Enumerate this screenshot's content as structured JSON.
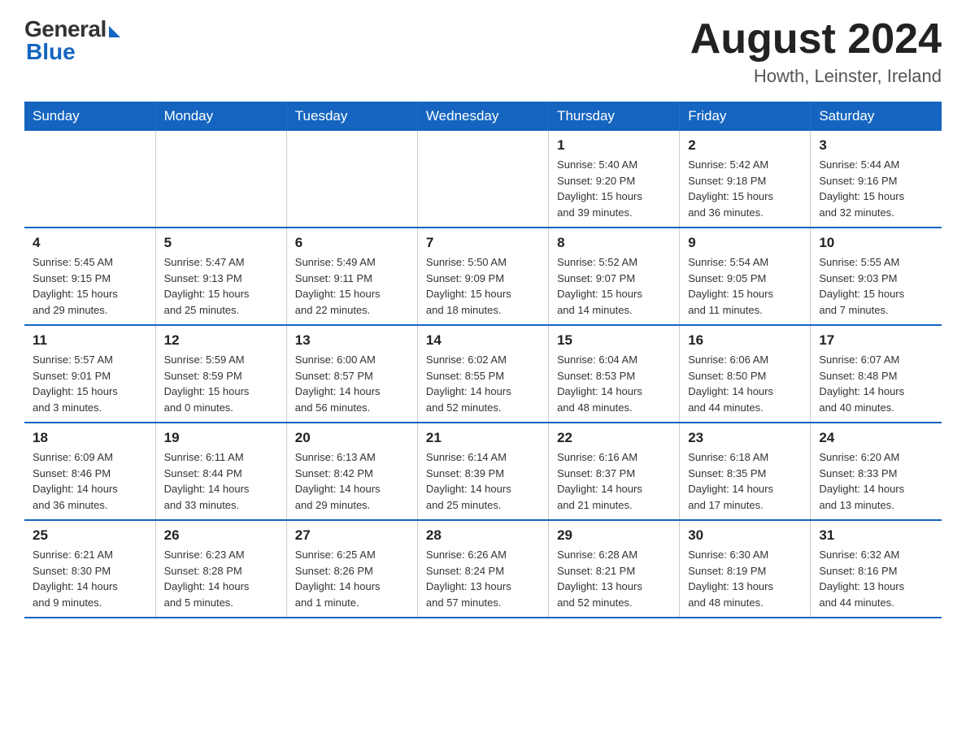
{
  "header": {
    "logo_general": "General",
    "logo_blue": "Blue",
    "month_title": "August 2024",
    "location": "Howth, Leinster, Ireland"
  },
  "days_of_week": [
    "Sunday",
    "Monday",
    "Tuesday",
    "Wednesday",
    "Thursday",
    "Friday",
    "Saturday"
  ],
  "weeks": [
    [
      {
        "day": "",
        "info": ""
      },
      {
        "day": "",
        "info": ""
      },
      {
        "day": "",
        "info": ""
      },
      {
        "day": "",
        "info": ""
      },
      {
        "day": "1",
        "info": "Sunrise: 5:40 AM\nSunset: 9:20 PM\nDaylight: 15 hours\nand 39 minutes."
      },
      {
        "day": "2",
        "info": "Sunrise: 5:42 AM\nSunset: 9:18 PM\nDaylight: 15 hours\nand 36 minutes."
      },
      {
        "day": "3",
        "info": "Sunrise: 5:44 AM\nSunset: 9:16 PM\nDaylight: 15 hours\nand 32 minutes."
      }
    ],
    [
      {
        "day": "4",
        "info": "Sunrise: 5:45 AM\nSunset: 9:15 PM\nDaylight: 15 hours\nand 29 minutes."
      },
      {
        "day": "5",
        "info": "Sunrise: 5:47 AM\nSunset: 9:13 PM\nDaylight: 15 hours\nand 25 minutes."
      },
      {
        "day": "6",
        "info": "Sunrise: 5:49 AM\nSunset: 9:11 PM\nDaylight: 15 hours\nand 22 minutes."
      },
      {
        "day": "7",
        "info": "Sunrise: 5:50 AM\nSunset: 9:09 PM\nDaylight: 15 hours\nand 18 minutes."
      },
      {
        "day": "8",
        "info": "Sunrise: 5:52 AM\nSunset: 9:07 PM\nDaylight: 15 hours\nand 14 minutes."
      },
      {
        "day": "9",
        "info": "Sunrise: 5:54 AM\nSunset: 9:05 PM\nDaylight: 15 hours\nand 11 minutes."
      },
      {
        "day": "10",
        "info": "Sunrise: 5:55 AM\nSunset: 9:03 PM\nDaylight: 15 hours\nand 7 minutes."
      }
    ],
    [
      {
        "day": "11",
        "info": "Sunrise: 5:57 AM\nSunset: 9:01 PM\nDaylight: 15 hours\nand 3 minutes."
      },
      {
        "day": "12",
        "info": "Sunrise: 5:59 AM\nSunset: 8:59 PM\nDaylight: 15 hours\nand 0 minutes."
      },
      {
        "day": "13",
        "info": "Sunrise: 6:00 AM\nSunset: 8:57 PM\nDaylight: 14 hours\nand 56 minutes."
      },
      {
        "day": "14",
        "info": "Sunrise: 6:02 AM\nSunset: 8:55 PM\nDaylight: 14 hours\nand 52 minutes."
      },
      {
        "day": "15",
        "info": "Sunrise: 6:04 AM\nSunset: 8:53 PM\nDaylight: 14 hours\nand 48 minutes."
      },
      {
        "day": "16",
        "info": "Sunrise: 6:06 AM\nSunset: 8:50 PM\nDaylight: 14 hours\nand 44 minutes."
      },
      {
        "day": "17",
        "info": "Sunrise: 6:07 AM\nSunset: 8:48 PM\nDaylight: 14 hours\nand 40 minutes."
      }
    ],
    [
      {
        "day": "18",
        "info": "Sunrise: 6:09 AM\nSunset: 8:46 PM\nDaylight: 14 hours\nand 36 minutes."
      },
      {
        "day": "19",
        "info": "Sunrise: 6:11 AM\nSunset: 8:44 PM\nDaylight: 14 hours\nand 33 minutes."
      },
      {
        "day": "20",
        "info": "Sunrise: 6:13 AM\nSunset: 8:42 PM\nDaylight: 14 hours\nand 29 minutes."
      },
      {
        "day": "21",
        "info": "Sunrise: 6:14 AM\nSunset: 8:39 PM\nDaylight: 14 hours\nand 25 minutes."
      },
      {
        "day": "22",
        "info": "Sunrise: 6:16 AM\nSunset: 8:37 PM\nDaylight: 14 hours\nand 21 minutes."
      },
      {
        "day": "23",
        "info": "Sunrise: 6:18 AM\nSunset: 8:35 PM\nDaylight: 14 hours\nand 17 minutes."
      },
      {
        "day": "24",
        "info": "Sunrise: 6:20 AM\nSunset: 8:33 PM\nDaylight: 14 hours\nand 13 minutes."
      }
    ],
    [
      {
        "day": "25",
        "info": "Sunrise: 6:21 AM\nSunset: 8:30 PM\nDaylight: 14 hours\nand 9 minutes."
      },
      {
        "day": "26",
        "info": "Sunrise: 6:23 AM\nSunset: 8:28 PM\nDaylight: 14 hours\nand 5 minutes."
      },
      {
        "day": "27",
        "info": "Sunrise: 6:25 AM\nSunset: 8:26 PM\nDaylight: 14 hours\nand 1 minute."
      },
      {
        "day": "28",
        "info": "Sunrise: 6:26 AM\nSunset: 8:24 PM\nDaylight: 13 hours\nand 57 minutes."
      },
      {
        "day": "29",
        "info": "Sunrise: 6:28 AM\nSunset: 8:21 PM\nDaylight: 13 hours\nand 52 minutes."
      },
      {
        "day": "30",
        "info": "Sunrise: 6:30 AM\nSunset: 8:19 PM\nDaylight: 13 hours\nand 48 minutes."
      },
      {
        "day": "31",
        "info": "Sunrise: 6:32 AM\nSunset: 8:16 PM\nDaylight: 13 hours\nand 44 minutes."
      }
    ]
  ]
}
